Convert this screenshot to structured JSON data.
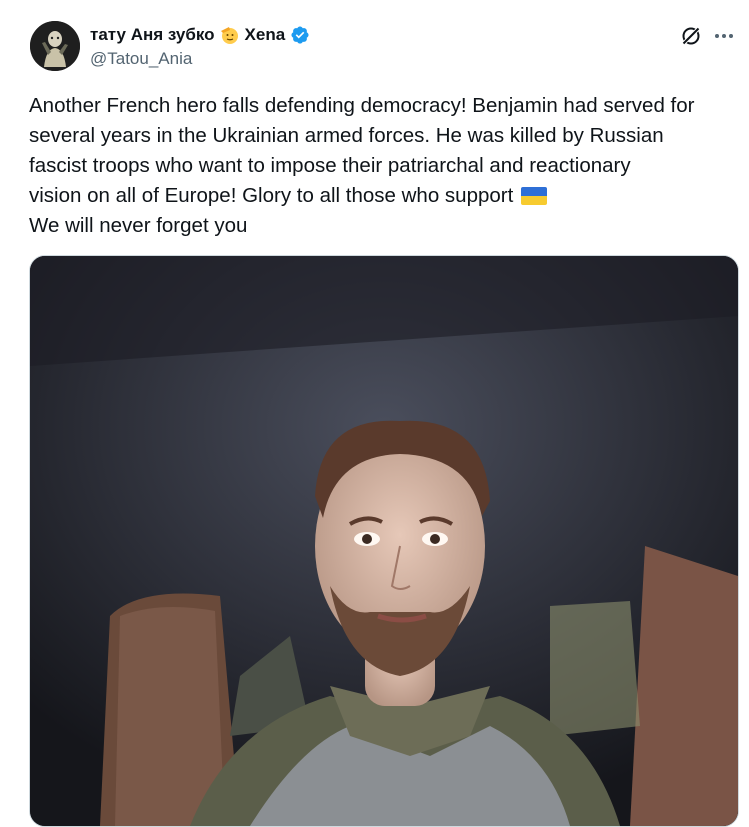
{
  "user": {
    "display_name_part1": "тату Аня зубко",
    "display_name_part2": "Xena",
    "handle": "@Tatou_Ania",
    "face_emoji_icon": "saluting-face-icon",
    "verified_icon": "verified-badge-icon"
  },
  "header_actions": {
    "grok_icon": "grok-icon",
    "more_icon": "more-icon"
  },
  "tweet": {
    "lines": [
      "Another French hero falls defending democracy! Benjamin had served for",
      "several years in the Ukrainian armed forces. He was killed by Russian",
      "fascist troops who want to impose their patriarchal and reactionary",
      "vision on all of Europe! Glory to all those who support",
      "We will never forget you"
    ],
    "flag_icon": "ukraine-flag-icon"
  },
  "colors": {
    "text": "#0f1419",
    "secondary": "#536471",
    "verified": "#1d9bf0",
    "flag_blue": "#2e6fd6",
    "flag_yellow": "#f7cb2f"
  }
}
